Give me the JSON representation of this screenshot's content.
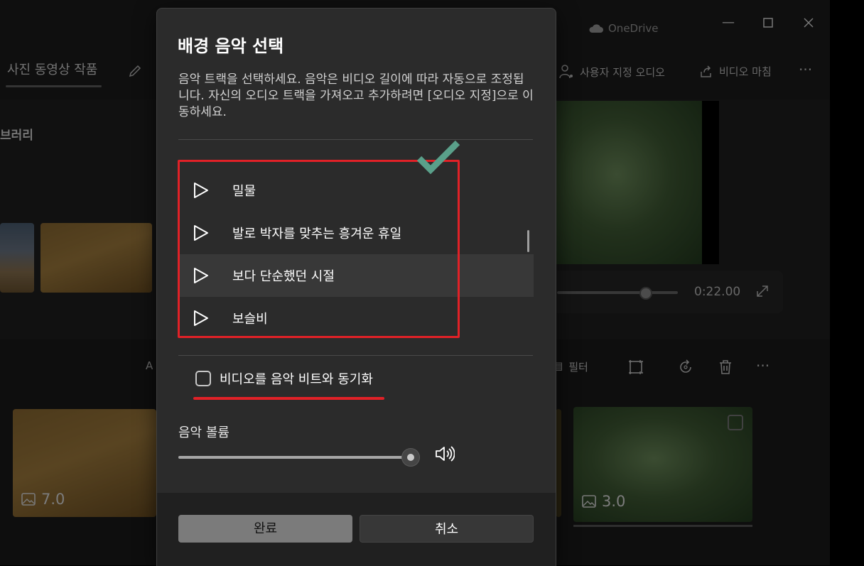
{
  "background_app": {
    "tab_title": "사진 동영상 작품",
    "library_label": "브러리",
    "cloud_label": "OneDrive",
    "toolbar": {
      "custom_audio": "사용자 지정 오디오",
      "finish_video": "비디오 마침"
    },
    "player_time": "0:22.00",
    "timeline_filter": "필터",
    "clip_durations": [
      "7.0",
      "3.0"
    ]
  },
  "dialog": {
    "title": "배경 음악 선택",
    "description": "음악 트랙을 선택하세요. 음악은 비디오 길이에 따라 자동으로 조정됩니다. 자신의 오디오 트랙을 가져오고 추가하려면 [오디오 지정]으로 이동하세요.",
    "tracks": [
      {
        "label": "밀물"
      },
      {
        "label": "발로 박자를 맞추는 흥겨운 휴일"
      },
      {
        "label": "보다 단순했던 시절",
        "selected": true
      },
      {
        "label": "보슬비"
      }
    ],
    "sync_checkbox": {
      "label": "비디오를 음악 비트와 동기화",
      "checked": false
    },
    "volume": {
      "label": "음악 볼륨",
      "level": 1.0
    },
    "buttons": {
      "done": "완료",
      "cancel": "취소"
    }
  },
  "icons": [
    "pencil-icon",
    "cloud-icon",
    "minimize-icon",
    "maximize-icon",
    "close-icon",
    "person-audio-icon",
    "share-icon",
    "more-icon",
    "expand-icon",
    "play-icon",
    "check-mark-icon",
    "speaker-icon",
    "image-icon",
    "crop-icon",
    "rotate-icon",
    "trash-icon",
    "filter-icon"
  ],
  "colors": {
    "annotation_red": "#e12127",
    "check_green": "#5aa08a",
    "dialog_bg": "#2b2b2b",
    "footer_bg": "#202020"
  }
}
